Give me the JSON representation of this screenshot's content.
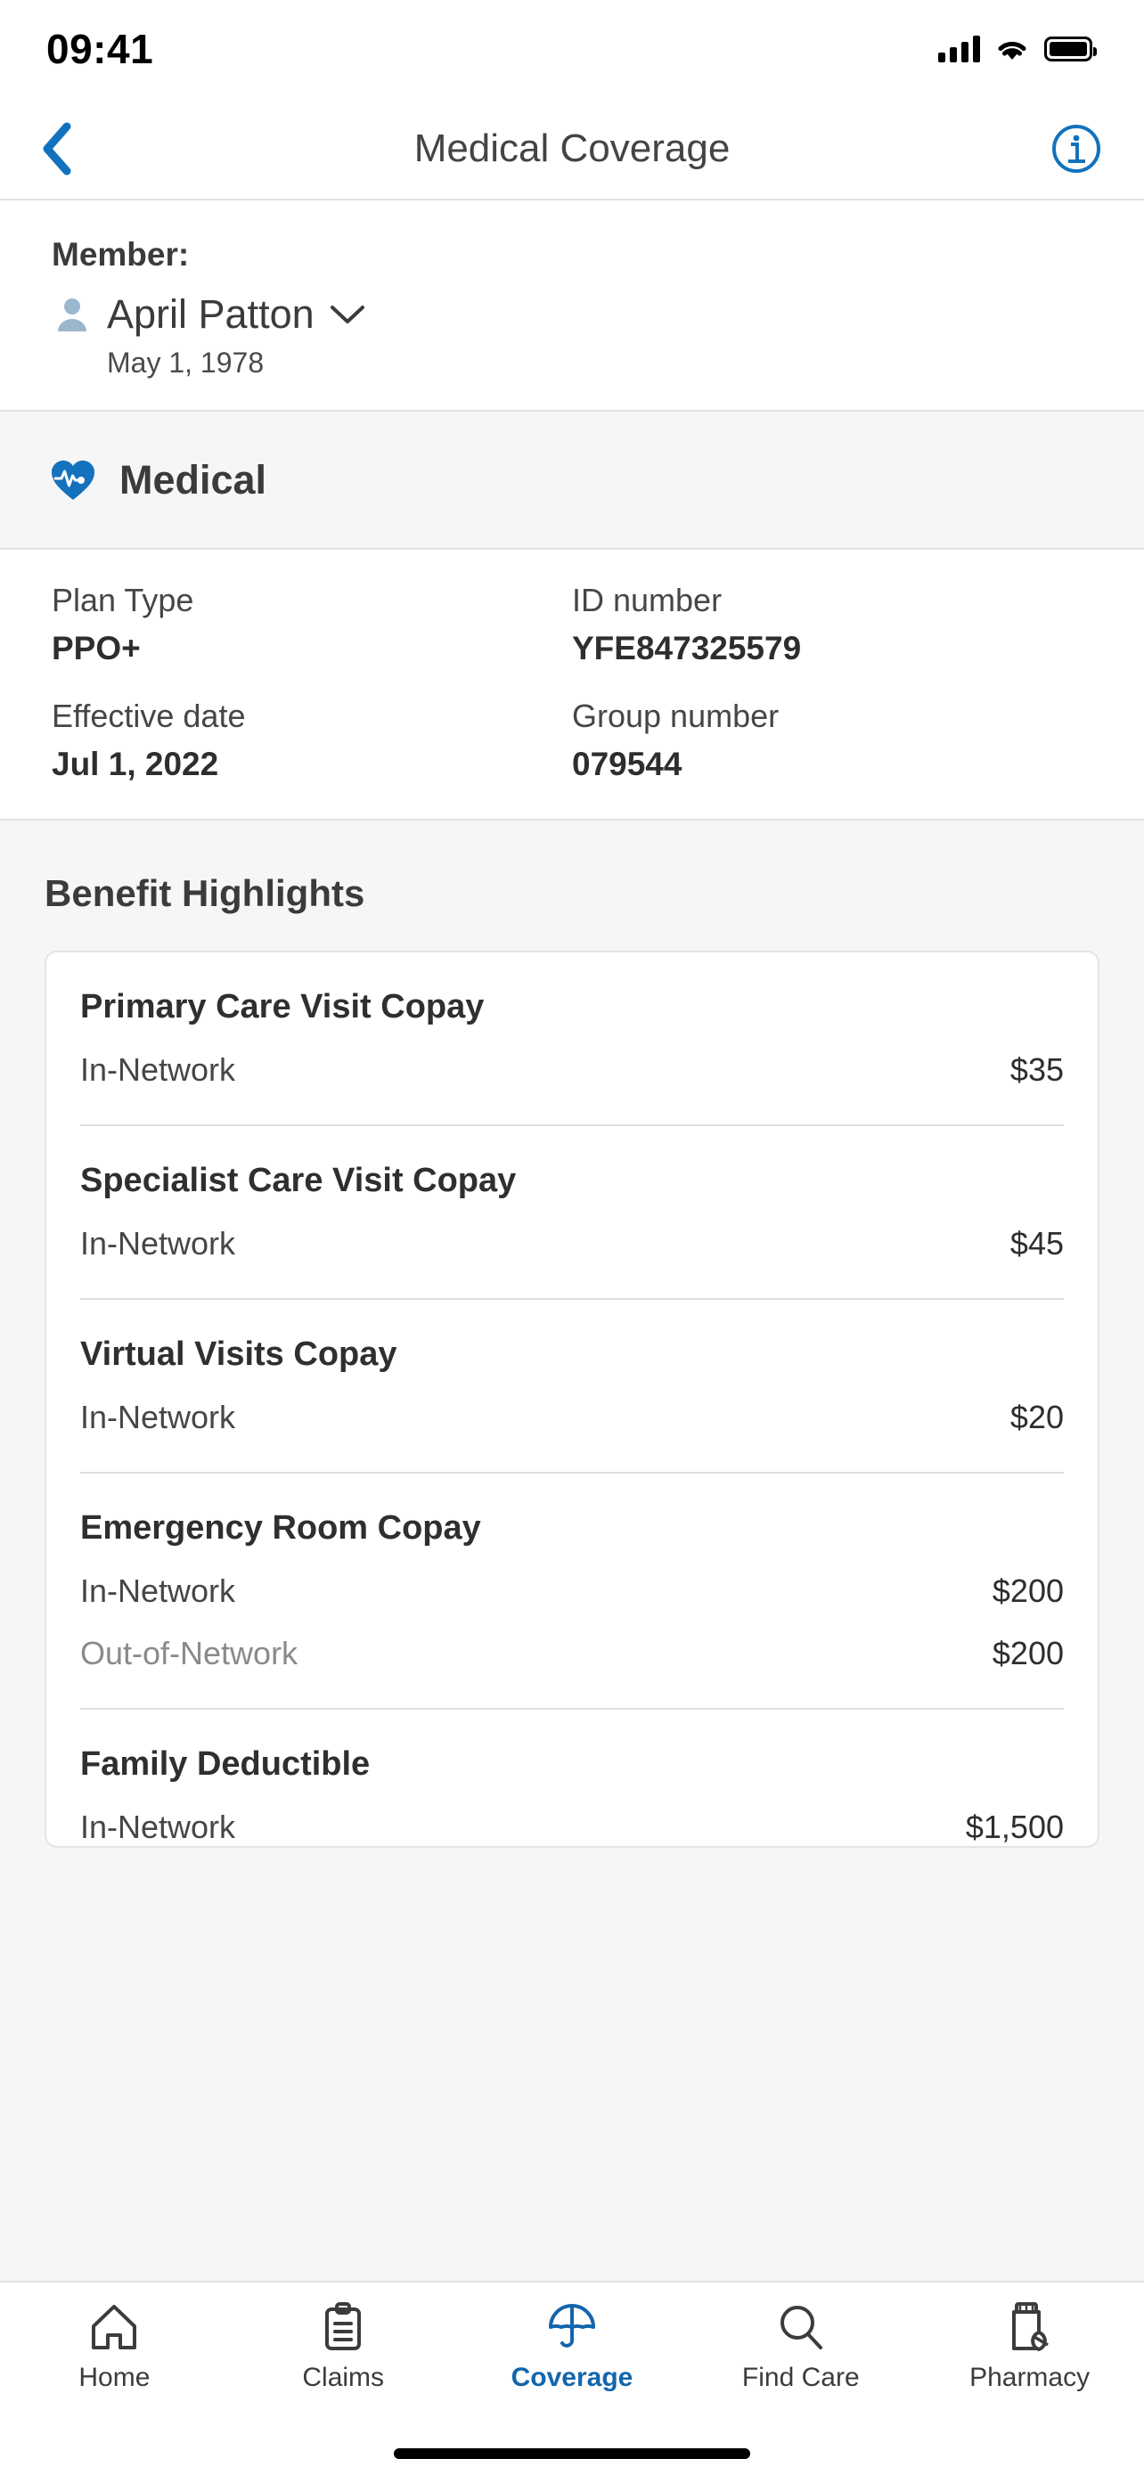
{
  "status_bar": {
    "time": "09:41",
    "signal_icon": "cellular-signal-icon",
    "wifi_icon": "wifi-icon",
    "battery_icon": "battery-full-icon"
  },
  "nav": {
    "back_icon": "chevron-left-icon",
    "title": "Medical Coverage",
    "info_icon": "info-circle-icon",
    "accent_color": "#1266ac"
  },
  "member": {
    "label": "Member:",
    "person_icon": "person-icon",
    "name": "April Patton",
    "chevron_icon": "chevron-down-icon",
    "dob": "May 1, 1978"
  },
  "coverage_section": {
    "icon": "heart-pulse-icon",
    "title": "Medical",
    "icon_color": "#1471bd",
    "details": [
      {
        "label": "Plan Type",
        "value": "PPO+"
      },
      {
        "label": "ID number",
        "value": "YFE847325579"
      },
      {
        "label": "Effective date",
        "value": "Jul 1, 2022"
      },
      {
        "label": "Group number",
        "value": "079544"
      }
    ]
  },
  "benefits": {
    "title": "Benefit Highlights",
    "items": [
      {
        "title": "Primary Care Visit Copay",
        "rows": [
          {
            "label": "In-Network",
            "value": "$35",
            "muted": false
          }
        ]
      },
      {
        "title": "Specialist Care Visit Copay",
        "rows": [
          {
            "label": "In-Network",
            "value": "$45",
            "muted": false
          }
        ]
      },
      {
        "title": "Virtual Visits Copay",
        "rows": [
          {
            "label": "In-Network",
            "value": "$20",
            "muted": false
          }
        ]
      },
      {
        "title": "Emergency Room Copay",
        "rows": [
          {
            "label": "In-Network",
            "value": "$200",
            "muted": false
          },
          {
            "label": "Out-of-Network",
            "value": "$200",
            "muted": true
          }
        ]
      },
      {
        "title": "Family Deductible",
        "rows": [
          {
            "label": "In-Network",
            "value": "$1,500",
            "muted": false
          }
        ]
      }
    ]
  },
  "tabbar": {
    "active_color": "#1266ac",
    "inactive_color": "#3c3c3c",
    "tabs": [
      {
        "label": "Home",
        "icon": "home-icon",
        "active": false
      },
      {
        "label": "Claims",
        "icon": "clipboard-icon",
        "active": false
      },
      {
        "label": "Coverage",
        "icon": "umbrella-icon",
        "active": true
      },
      {
        "label": "Find Care",
        "icon": "search-icon",
        "active": false
      },
      {
        "label": "Pharmacy",
        "icon": "pill-bottle-icon",
        "active": false
      }
    ]
  }
}
